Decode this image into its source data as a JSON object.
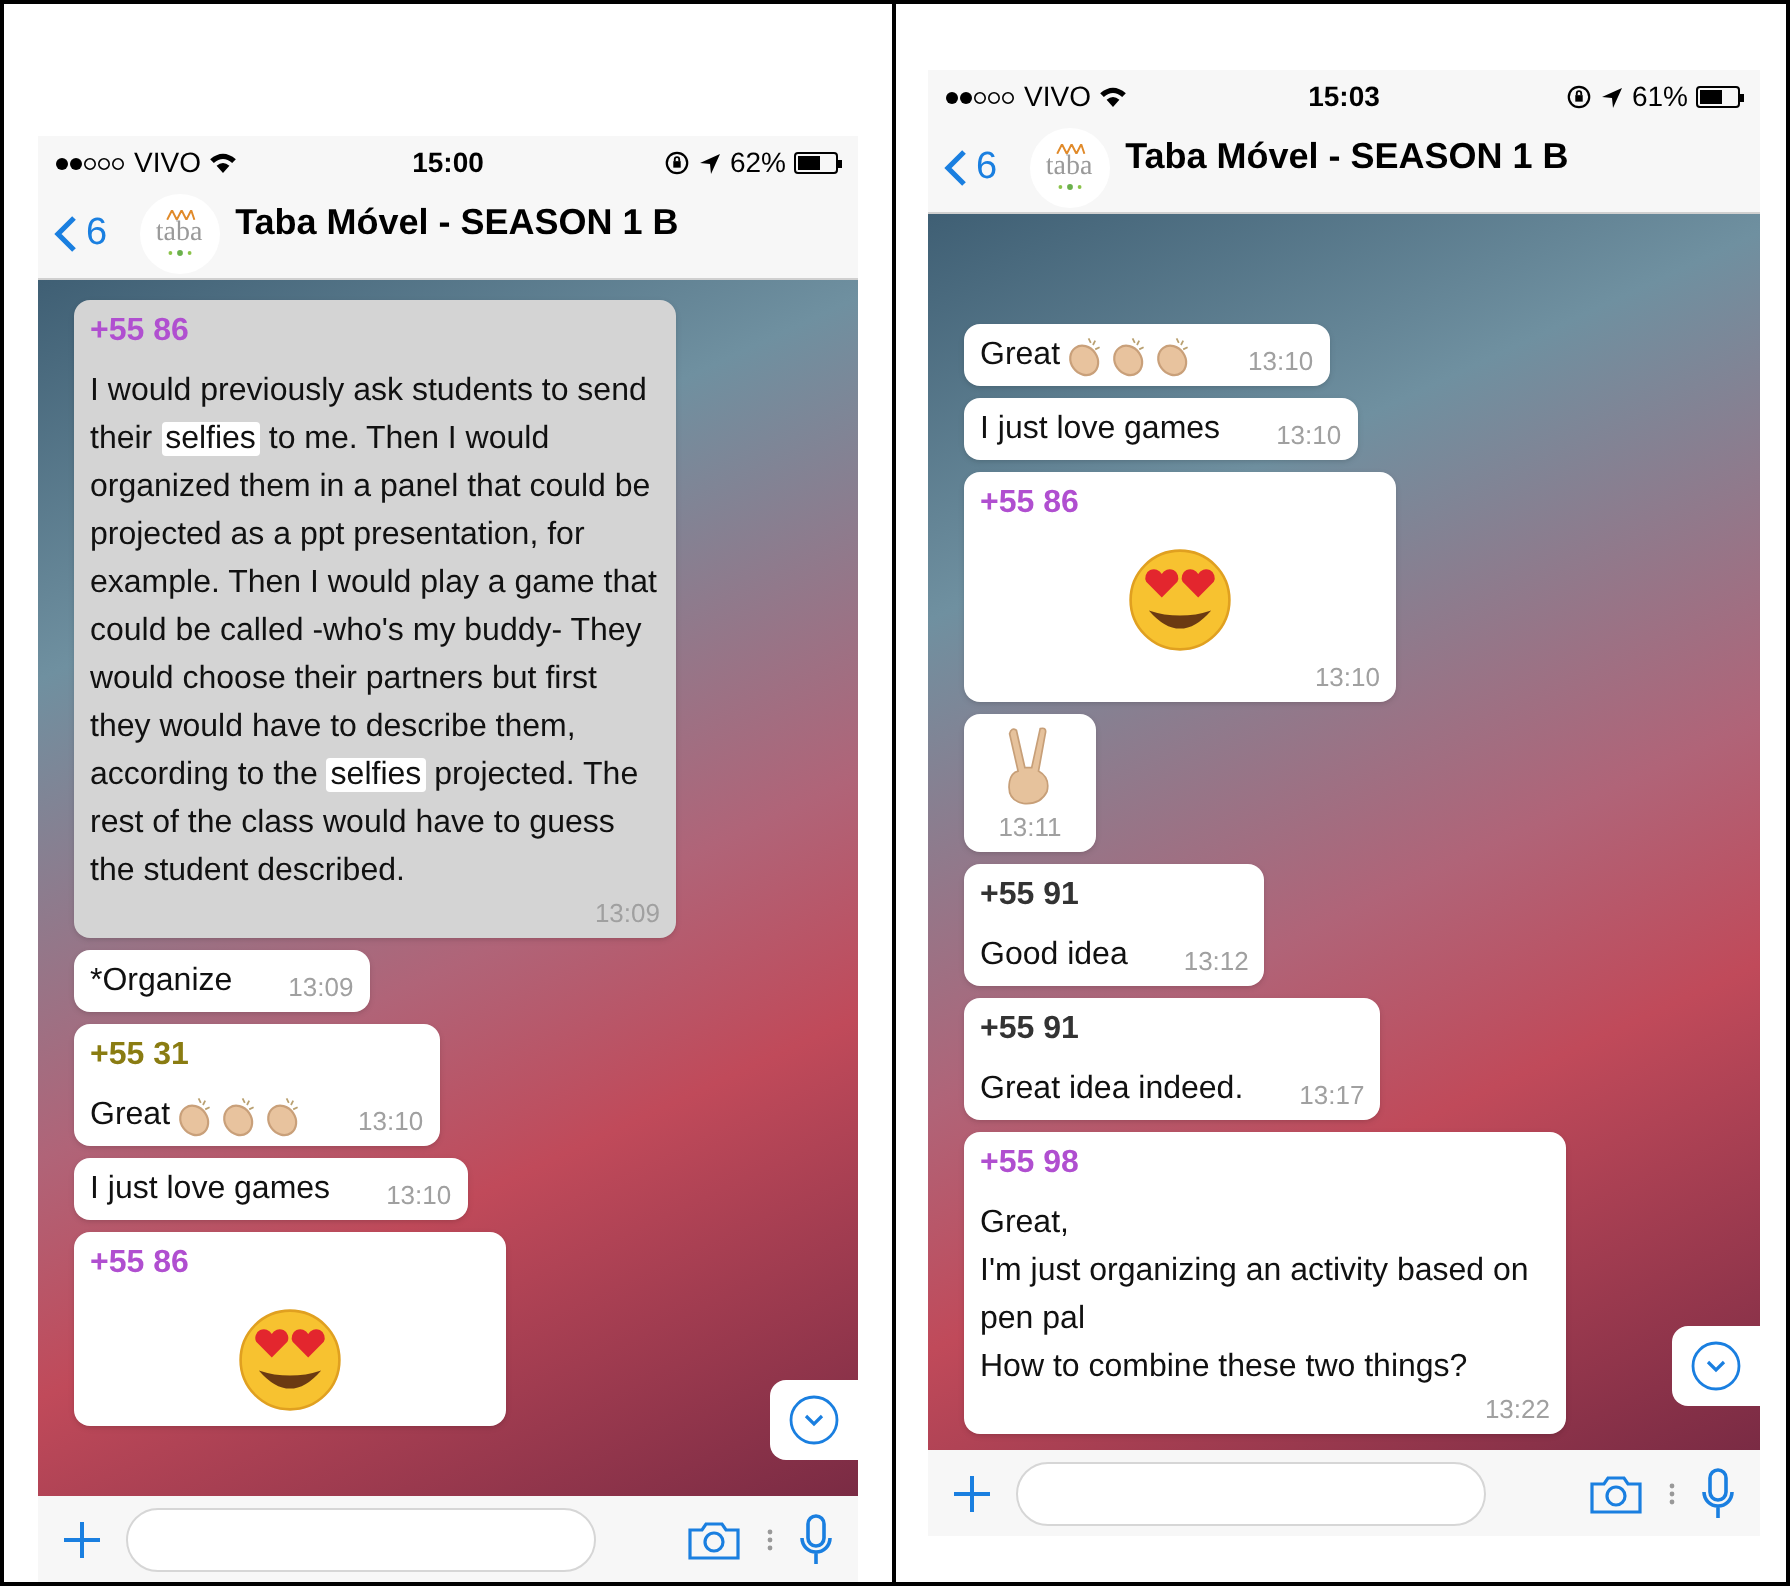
{
  "screens": [
    {
      "status_bar": {
        "carrier": "VIVO",
        "time": "15:00",
        "battery": "62%",
        "level": 0.62
      },
      "header": {
        "back_count": "6",
        "avatar_text": "taba",
        "title": "Taba Móvel - SEASON 1 B"
      },
      "messages": [
        {
          "kind": "text",
          "selected": true,
          "sender": "+55 86",
          "color": "#b04fd0",
          "segments": [
            {
              "kind": "text",
              "text": "I would previously ask students to send their "
            },
            {
              "kind": "highlight",
              "text": "selfies"
            },
            {
              "kind": "text",
              "text": " to me. Then I would organized them in a panel that could be projected as a ppt presentation, for example. Then I would play a game that could be called -who's my buddy- They would choose their partners but first they would have to describe them, according to the "
            },
            {
              "kind": "highlight",
              "text": "selfies"
            },
            {
              "kind": "text",
              "text": " projected. The rest of the class would have to guess the student described."
            }
          ],
          "time": "13:09"
        },
        {
          "kind": "text",
          "selected": false,
          "segments": [
            {
              "kind": "text",
              "text": "*Organize"
            }
          ],
          "time": "13:09"
        },
        {
          "kind": "text",
          "selected": false,
          "sender": "+55 31",
          "color": "#8a7c12",
          "segments": [
            {
              "kind": "text",
              "text": "Great"
            },
            {
              "kind": "clap"
            },
            {
              "kind": "clap"
            },
            {
              "kind": "clap"
            }
          ],
          "time": "13:10"
        },
        {
          "kind": "text",
          "selected": false,
          "segments": [
            {
              "kind": "text",
              "text": "I just love games"
            }
          ],
          "time": "13:10"
        },
        {
          "kind": "heart-eyes",
          "selected": false,
          "sender": "+55 86",
          "color": "#b04fd0"
        }
      ]
    },
    {
      "status_bar": {
        "carrier": "VIVO",
        "time": "15:03",
        "battery": "61%",
        "level": 0.61
      },
      "header": {
        "back_count": "6",
        "avatar_text": "taba",
        "title": "Taba Móvel - SEASON 1 B"
      },
      "messages": [
        {
          "kind": "text",
          "selected": false,
          "segments": [
            {
              "kind": "text",
              "text": "Great"
            },
            {
              "kind": "clap"
            },
            {
              "kind": "clap"
            },
            {
              "kind": "clap"
            }
          ],
          "time": "13:10"
        },
        {
          "kind": "text",
          "selected": false,
          "segments": [
            {
              "kind": "text",
              "text": "I just love games"
            }
          ],
          "time": "13:10"
        },
        {
          "kind": "heart-eyes",
          "selected": false,
          "sender": "+55 86",
          "color": "#b04fd0",
          "time": "13:10"
        },
        {
          "kind": "victory",
          "selected": false,
          "time": "13:11"
        },
        {
          "kind": "text",
          "selected": false,
          "sender": "+55 91",
          "color": "#333333",
          "segments": [
            {
              "kind": "text",
              "text": "Good idea"
            }
          ],
          "time": "13:12"
        },
        {
          "kind": "text",
          "selected": false,
          "sender": "+55 91",
          "color": "#333333",
          "segments": [
            {
              "kind": "text",
              "text": "Great idea indeed."
            }
          ],
          "time": "13:17"
        },
        {
          "kind": "text",
          "selected": false,
          "sender": "+55 98",
          "color": "#b04fd0",
          "segments": [
            {
              "kind": "text",
              "text": "Great,\nI'm just organizing an activity based on pen pal\nHow to combine these two things?"
            }
          ],
          "time": "13:22"
        }
      ]
    }
  ]
}
